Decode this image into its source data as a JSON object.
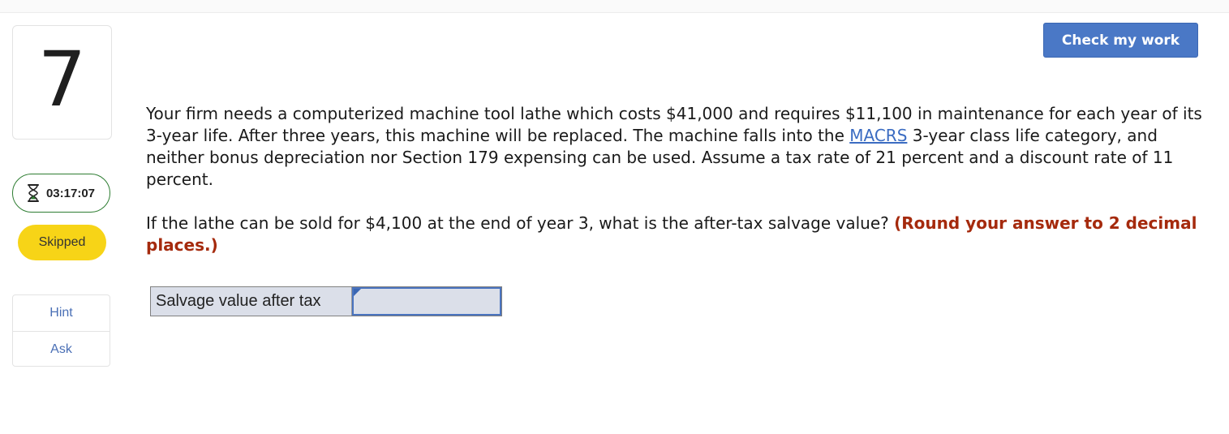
{
  "question": {
    "number": "7",
    "timer": "03:17:07",
    "status": "Skipped",
    "check_button": "Check my work",
    "paragraph1_before_link": "Your firm needs a computerized machine tool lathe which costs $41,000 and requires $11,100 in maintenance for each year of its 3-year life. After three years, this machine will be replaced. The machine falls into the ",
    "link_text": "MACRS",
    "paragraph1_after_link": " 3-year class life category, and neither bonus depreciation nor Section 179 expensing can be used. Assume a tax rate of 21 percent and a discount rate of 11 percent.",
    "paragraph2": "If the lathe can be sold for $4,100 at the end of year 3, what is the after-tax salvage value? ",
    "instruction": "(Round your answer to 2 decimal places.)"
  },
  "help": {
    "hint": "Hint",
    "ask": "Ask"
  },
  "answer": {
    "label": "Salvage value after tax",
    "value": ""
  },
  "icons": {
    "timer": "hourglass-icon"
  },
  "colors": {
    "button": "#4a78c6",
    "link": "#3b6cc2",
    "instruction": "#a52a0d",
    "status_pill": "#f7d417",
    "timer_border": "#2e7d32",
    "answer_fill": "#dbdfe9"
  }
}
